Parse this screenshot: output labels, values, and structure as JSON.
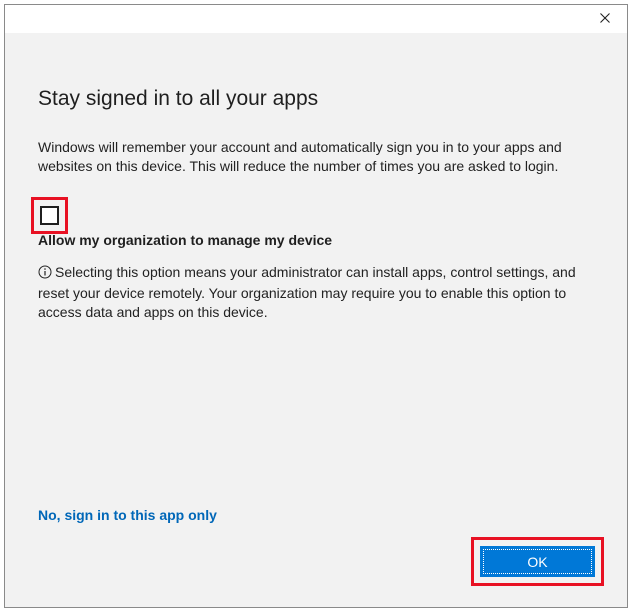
{
  "window": {
    "close_icon": "close-icon"
  },
  "dialog": {
    "heading": "Stay signed in to all your apps",
    "description": "Windows will remember your account and automatically sign you in to your apps and websites on this device. This will reduce the number of times you are asked to login.",
    "manage_checkbox": {
      "checked": false,
      "label": "Allow my organization to manage my device"
    },
    "info_icon": "info-icon",
    "info_text": "Selecting this option means your administrator can install apps, control settings, and reset your device remotely. Your organization may require you to enable this option to access data and apps on this device.",
    "alt_link": "No, sign in to this app only",
    "ok_label": "OK"
  },
  "colors": {
    "accent": "#0078d7",
    "link": "#0067b8",
    "highlight": "#e81123",
    "background": "#f2f2f2"
  }
}
